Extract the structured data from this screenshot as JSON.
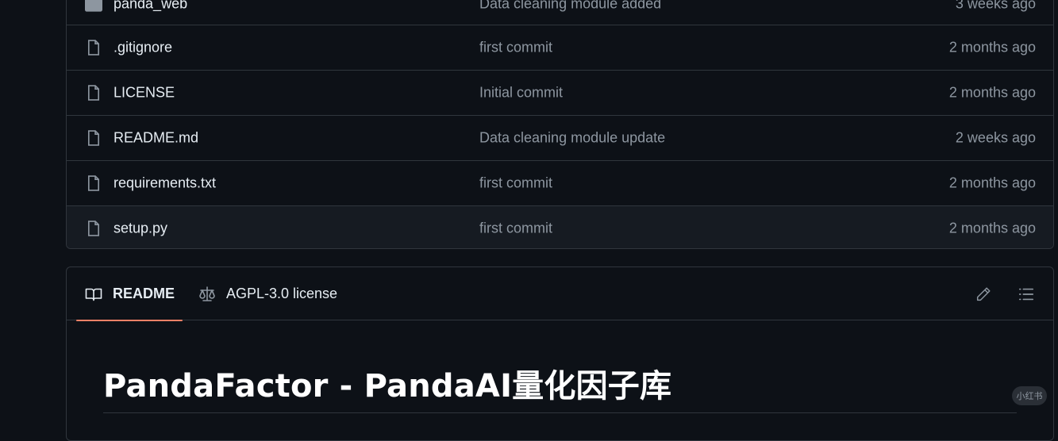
{
  "files": [
    {
      "name": "panda_web",
      "type": "folder",
      "message": "Data cleaning module added",
      "age": "3 weeks ago"
    },
    {
      "name": ".gitignore",
      "type": "file",
      "message": "first commit",
      "age": "2 months ago"
    },
    {
      "name": "LICENSE",
      "type": "file",
      "message": "Initial commit",
      "age": "2 months ago"
    },
    {
      "name": "README.md",
      "type": "file",
      "message": "Data cleaning module update",
      "age": "2 weeks ago"
    },
    {
      "name": "requirements.txt",
      "type": "file",
      "message": "first commit",
      "age": "2 months ago"
    },
    {
      "name": "setup.py",
      "type": "file",
      "message": "first commit",
      "age": "2 months ago"
    }
  ],
  "readme": {
    "tabs": {
      "readme": "README",
      "license": "AGPL-3.0 license"
    },
    "title": "PandaFactor - PandaAI量化因子库"
  },
  "watermark": "小红书",
  "colors": {
    "background": "#0d1117",
    "border": "#30363d",
    "muted": "#8d96a0",
    "accent": "#f78166"
  }
}
